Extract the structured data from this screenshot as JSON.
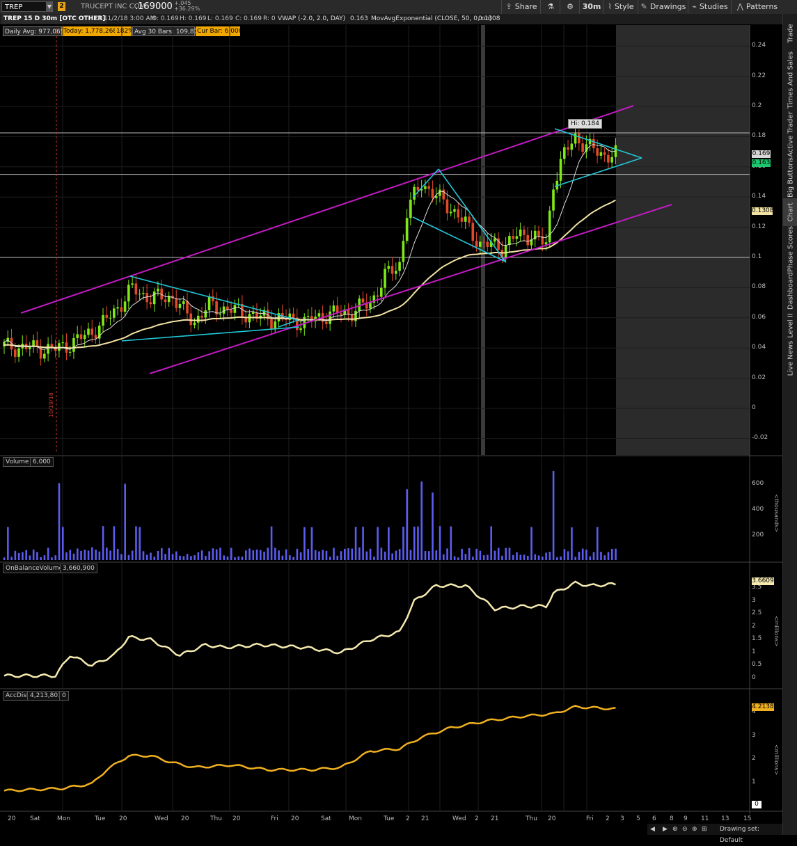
{
  "toolbar": {
    "symbol": "TREP",
    "link_number": "2",
    "company": "TRUCEPT INC COM",
    "price": ".169000",
    "change": "+.045",
    "change_pct": "+36.29%",
    "buttons": [
      {
        "icon": "share-icon",
        "label": "Share"
      },
      {
        "icon": "flask-icon",
        "label": ""
      },
      {
        "icon": "gear-icon",
        "label": ""
      },
      {
        "icon": "timeframe",
        "label": "30m"
      },
      {
        "icon": "style-icon",
        "label": "Style"
      },
      {
        "icon": "pencil-icon",
        "label": "Drawings"
      },
      {
        "icon": "studies-icon",
        "label": "Studies"
      },
      {
        "icon": "patterns-icon",
        "label": "Patterns"
      }
    ]
  },
  "header": {
    "desc": "TREP 15 D 30m [OTC OTHER]",
    "date": "D: 11/2/18 3:00 AM",
    "open": "O: 0.169",
    "high": "H: 0.169",
    "low": "L: 0.169",
    "close": "C: 0.169",
    "range": "R: 0",
    "vwap": "VWAP (-2.0, 2.0, DAY)",
    "vwap_val": "0.163",
    "ema": "MovAvgExponential (CLOSE, 50, 0, no)",
    "ema_val": "0.1308"
  },
  "stats": {
    "daily_avg": "Daily Avg: 977,065",
    "today": "Today: 1,778,268",
    "pct": "182%",
    "avg30": "Avg 30 Bars: 109,878",
    "cur_bar": "Cur Bar: 6,000"
  },
  "price_axis": [
    "0.24",
    "0.22",
    "0.2",
    "0.18",
    "0.16",
    "0.14",
    "0.12",
    "0.1",
    "0.08",
    "0.06",
    "0.04",
    "0.02",
    "0",
    "-0.02"
  ],
  "price_tags": {
    "last": "0.169",
    "vwap": "0.163",
    "ema": "0.1308"
  },
  "hi_label": "Hi: 0.184",
  "vline_date": "10/19/18",
  "volume": {
    "title": "Volume",
    "value": "6,000",
    "axis": [
      "600",
      "400",
      "200"
    ],
    "unit": "<thousands>"
  },
  "obv": {
    "title": "OnBalanceVolume",
    "value": "3,660,900",
    "axis": [
      "3.5",
      "3",
      "2.5",
      "2",
      "1.5",
      "1",
      "0.5",
      "0"
    ],
    "unit": "<millions>",
    "tag": "3.6609"
  },
  "accdist": {
    "title": "AccDist",
    "value": "4,213,801",
    "value2": "0",
    "axis": [
      "4",
      "3",
      "2",
      "1"
    ],
    "unit": "<millions>",
    "tag": "4.2138",
    "zero": "0"
  },
  "xaxis": [
    "20",
    "Sat",
    "Mon",
    "Tue",
    "20",
    "Wed",
    "20",
    "Thu",
    "20",
    "Fri",
    "20",
    "Sat",
    "Mon",
    "Tue",
    "2",
    "21",
    "Wed",
    "2",
    "21",
    "Thu",
    "20",
    "Fri",
    "2",
    "3",
    "5",
    "6",
    "8",
    "9",
    "11",
    "13",
    "15"
  ],
  "right_tabs": [
    "Trade",
    "Times And Sales",
    "Active Trader",
    "Big Buttons",
    "Chart",
    "Phase Scores",
    "Dashboard",
    "Level II",
    "Live News"
  ],
  "footer": {
    "drawing_set": "Drawing set: Default"
  },
  "colors": {
    "up_candle": "#7fe818",
    "down_candle": "#e04a2a",
    "channel": "#c21bc2",
    "pattern": "#21c8d8",
    "ema": "#f2e3a4",
    "volume": "#5c5cf0",
    "obv": "#f5eab0",
    "accdist": "#f0b020"
  }
}
